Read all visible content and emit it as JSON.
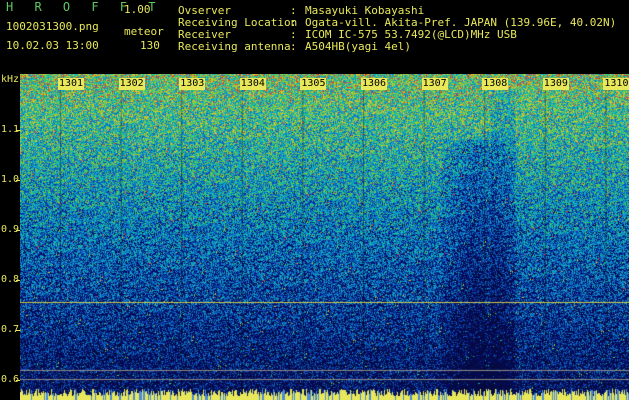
{
  "header": {
    "program_title": "H R O F F T",
    "version": "1.00",
    "filename": "1002031300.png",
    "mode": "meteor",
    "datetime": "10.02.03 13:00",
    "count": "130",
    "fields": [
      {
        "label": "Ovserver",
        "value": "Masayuki Kobayashi"
      },
      {
        "label": "Receiving Location",
        "value": "Ogata-vill. Akita-Pref. JAPAN (139.96E, 40.02N)"
      },
      {
        "label": "Receiver",
        "value": "ICOM IC-575 53.7492(@LCD)MHz USB"
      },
      {
        "label": "Receiving antenna",
        "value": "A504HB(yagi 4el)"
      }
    ]
  },
  "axis": {
    "unit": "kHz",
    "y_labels": [
      "1.1",
      "1.0",
      "0.9",
      "0.8",
      "0.7",
      "0.6"
    ],
    "x_labels": [
      "1301",
      "1302",
      "1303",
      "1304",
      "1305",
      "1306",
      "1307",
      "1308",
      "1309",
      "1310"
    ]
  },
  "colors": {
    "header_green": "#5ec85e",
    "header_yellow": "#e8e85a",
    "background": "#000000",
    "spectrum_low": "#0a1a6e",
    "spectrum_mid": "#1e8cd0",
    "spectrum_high": "#7ed84a"
  }
}
